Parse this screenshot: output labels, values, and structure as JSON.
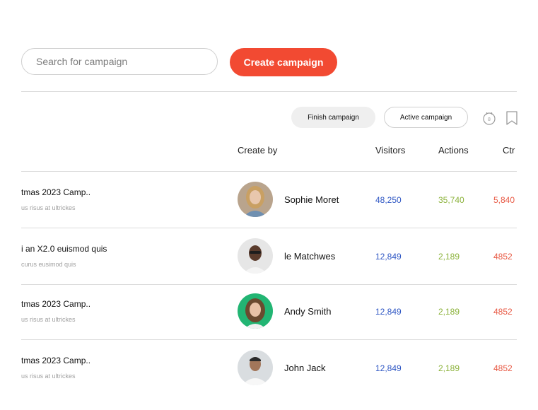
{
  "toolbar": {
    "search_placeholder": "Search for campaign",
    "create_label": "Create campaign"
  },
  "filters": {
    "finish_label": "Finish campaign",
    "active_label": "Active campaign",
    "calendar_icon": "calendar-icon",
    "bookmark_icon": "bookmark-icon"
  },
  "table": {
    "headers": {
      "create_by": "Create by",
      "visitors": "Visitors",
      "actions": "Actions",
      "ctr": "Ctr"
    },
    "rows": [
      {
        "title": "tmas 2023 Camp..",
        "subtitle": "us risus at ultrickes",
        "creator": "Sophie Moret",
        "visitors": "48,250",
        "actions": "35,740",
        "ctr": "5,840"
      },
      {
        "title": "i an X2.0 euismod quis",
        "subtitle": "curus eusimod quis",
        "creator": "le Matchwes",
        "visitors": "12,849",
        "actions": "2,189",
        "ctr": "4852"
      },
      {
        "title": "tmas 2023 Camp..",
        "subtitle": "us risus at ultrickes",
        "creator": "Andy Smith",
        "visitors": "12,849",
        "actions": "2,189",
        "ctr": "4852"
      },
      {
        "title": "tmas 2023 Camp..",
        "subtitle": "us risus at ultrickes",
        "creator": "John Jack",
        "visitors": "12,849",
        "actions": "2,189",
        "ctr": "4852"
      }
    ]
  },
  "colors": {
    "accent": "#f24a32",
    "visitors": "#2f57c4",
    "actions": "#8bb23a",
    "ctr": "#e85a45"
  }
}
